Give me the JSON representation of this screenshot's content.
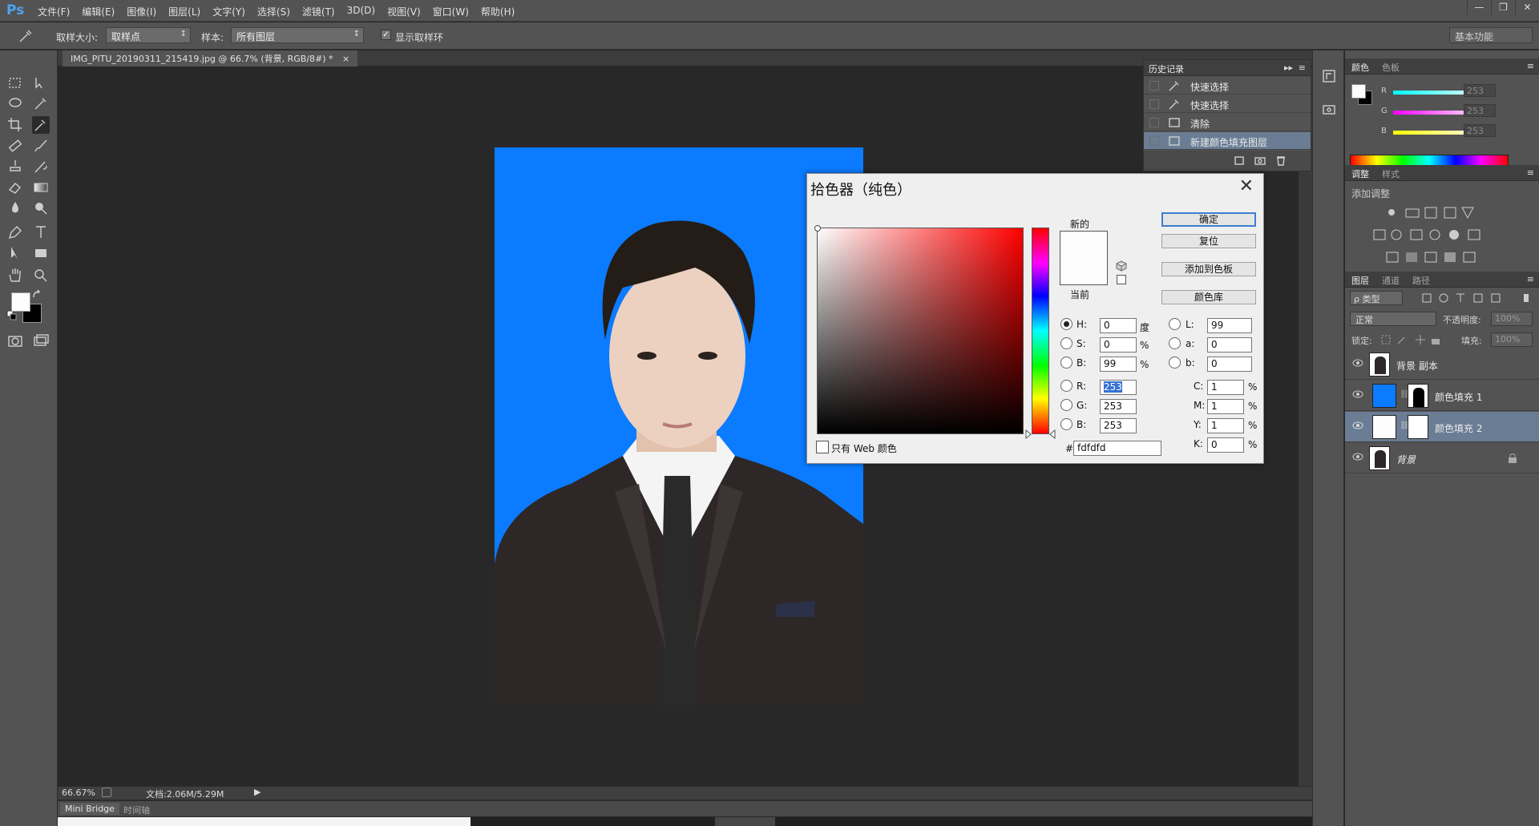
{
  "app": {
    "logo": "Ps",
    "menu": [
      "文件(F)",
      "编辑(E)",
      "图像(I)",
      "图层(L)",
      "文字(Y)",
      "选择(S)",
      "滤镜(T)",
      "3D(D)",
      "视图(V)",
      "窗口(W)",
      "帮助(H)"
    ],
    "window_controls": [
      "—",
      "❐",
      "✕"
    ]
  },
  "options": {
    "sample_size_label": "取样大小:",
    "sample_size_value": "取样点",
    "sample_label": "样本:",
    "sample_value": "所有图层",
    "show_ring_label": "显示取样环",
    "show_ring_checked": true,
    "workspace": "基本功能"
  },
  "document": {
    "tab_title": "IMG_PITU_20190311_215419.jpg @ 66.7% (背景, RGB/8#) *",
    "tab_close": "×",
    "zoom": "66.67%",
    "doc_info": "文档:2.06M/5.29M",
    "background_color": "#0b7bff"
  },
  "bottom": {
    "mini_bridge": "Mini Bridge",
    "timeline": "时间轴"
  },
  "history": {
    "tab": "历史记录",
    "items": [
      "快速选择",
      "快速选择",
      "清除",
      "新建颜色填充图层"
    ],
    "selected_index": 3
  },
  "color_panel": {
    "tabs": [
      "颜色",
      "色板"
    ],
    "r_label": "R",
    "g_label": "G",
    "b_label": "B",
    "r": "253",
    "g": "253",
    "b": "253"
  },
  "adjustments": {
    "tabs": [
      "调整",
      "样式"
    ],
    "subtitle": "添加调整"
  },
  "layers": {
    "tabs": [
      "图层",
      "通道",
      "路径"
    ],
    "filter": "ρ 类型",
    "blend": "正常",
    "opacity_label": "不透明度:",
    "opacity": "100%",
    "lock_label": "锁定:",
    "fill_label": "填充:",
    "fill": "100%",
    "items": [
      {
        "name": "背景 副本",
        "selected": false
      },
      {
        "name": "颜色填充 1",
        "selected": false
      },
      {
        "name": "颜色填充 2",
        "selected": true
      },
      {
        "name": "背景",
        "selected": false
      }
    ]
  },
  "dialog": {
    "title": "拾色器（纯色）",
    "close": "✕",
    "new_label": "新的",
    "current_label": "当前",
    "new_color": "#fdfdfd",
    "current_color": "#fdfdfd",
    "buttons": {
      "ok": "确定",
      "reset": "复位",
      "add_swatch": "添加到色板",
      "color_lib": "颜色库"
    },
    "hsb": {
      "h_label": "H:",
      "h": "0",
      "h_unit": "度",
      "s_label": "S:",
      "s": "0",
      "s_unit": "%",
      "b_label": "B:",
      "b": "99",
      "b_unit": "%"
    },
    "rgb": {
      "r_label": "R:",
      "r": "253",
      "g_label": "G:",
      "g": "253",
      "b_label": "B:",
      "b": "253"
    },
    "lab": {
      "l_label": "L:",
      "l": "99",
      "a_label": "a:",
      "a": "0",
      "b_label": "b:",
      "b": "0"
    },
    "cmyk": {
      "c_label": "C:",
      "c": "1",
      "m_label": "M:",
      "m": "1",
      "y_label": "Y:",
      "y": "1",
      "k_label": "K:",
      "k": "0",
      "unit": "%"
    },
    "web_only": "只有 Web 颜色",
    "hex_label": "#",
    "hex": "fdfdfd"
  }
}
